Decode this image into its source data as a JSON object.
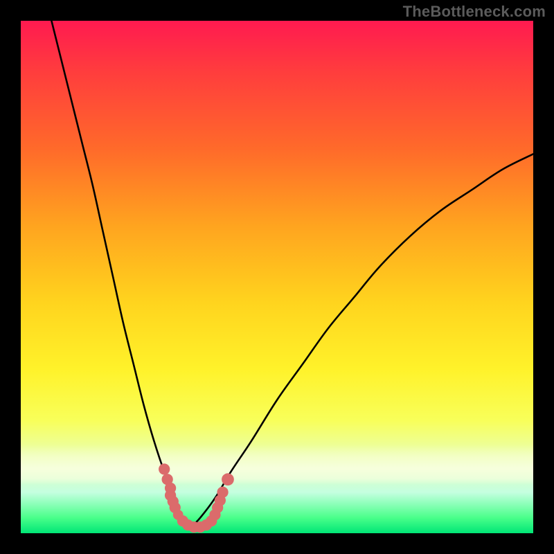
{
  "watermark": "TheBottleneck.com",
  "chart_data": {
    "type": "line",
    "title": "",
    "xlabel": "",
    "ylabel": "",
    "xlim": [
      0,
      100
    ],
    "ylim": [
      0,
      100
    ],
    "grid": false,
    "legend": false,
    "background_gradient": {
      "top_color": "#ff1a50",
      "mid_colors": [
        "#ff6a2a",
        "#ffd41e",
        "#f8ff5a"
      ],
      "bottom_color": "#00e676"
    },
    "series": [
      {
        "name": "left-curve",
        "x": [
          6,
          8,
          10,
          12,
          14,
          16,
          18,
          20,
          22,
          24,
          26,
          28,
          30,
          31,
          32,
          33
        ],
        "y": [
          100,
          92,
          84,
          76,
          68,
          59,
          50,
          41,
          33,
          25,
          18,
          12,
          7,
          4,
          2,
          1
        ]
      },
      {
        "name": "right-curve",
        "x": [
          33,
          35,
          38,
          41,
          45,
          50,
          55,
          60,
          65,
          70,
          76,
          82,
          88,
          94,
          100
        ],
        "y": [
          1,
          3,
          7,
          12,
          18,
          26,
          33,
          40,
          46,
          52,
          58,
          63,
          67,
          71,
          74
        ]
      }
    ],
    "markers": {
      "name": "bottom-cluster",
      "color": "#db6b6b",
      "points": [
        {
          "x": 28.0,
          "y": 12.5,
          "r": 1.1
        },
        {
          "x": 28.6,
          "y": 10.5,
          "r": 1.1
        },
        {
          "x": 29.2,
          "y": 8.8,
          "r": 1.1
        },
        {
          "x": 29.2,
          "y": 7.4,
          "r": 1.1
        },
        {
          "x": 29.7,
          "y": 6.2,
          "r": 1.1
        },
        {
          "x": 30.1,
          "y": 5.0,
          "r": 1.1
        },
        {
          "x": 30.7,
          "y": 3.6,
          "r": 1.0
        },
        {
          "x": 31.6,
          "y": 2.4,
          "r": 1.1
        },
        {
          "x": 32.6,
          "y": 1.6,
          "r": 1.1
        },
        {
          "x": 33.8,
          "y": 1.2,
          "r": 1.1
        },
        {
          "x": 35.0,
          "y": 1.2,
          "r": 1.1
        },
        {
          "x": 36.2,
          "y": 1.6,
          "r": 1.1
        },
        {
          "x": 37.2,
          "y": 2.4,
          "r": 1.1
        },
        {
          "x": 37.9,
          "y": 3.6,
          "r": 1.1
        },
        {
          "x": 38.4,
          "y": 5.0,
          "r": 1.1
        },
        {
          "x": 38.9,
          "y": 6.4,
          "r": 1.1
        },
        {
          "x": 39.4,
          "y": 8.0,
          "r": 1.1
        },
        {
          "x": 40.4,
          "y": 10.5,
          "r": 1.2
        }
      ]
    }
  }
}
